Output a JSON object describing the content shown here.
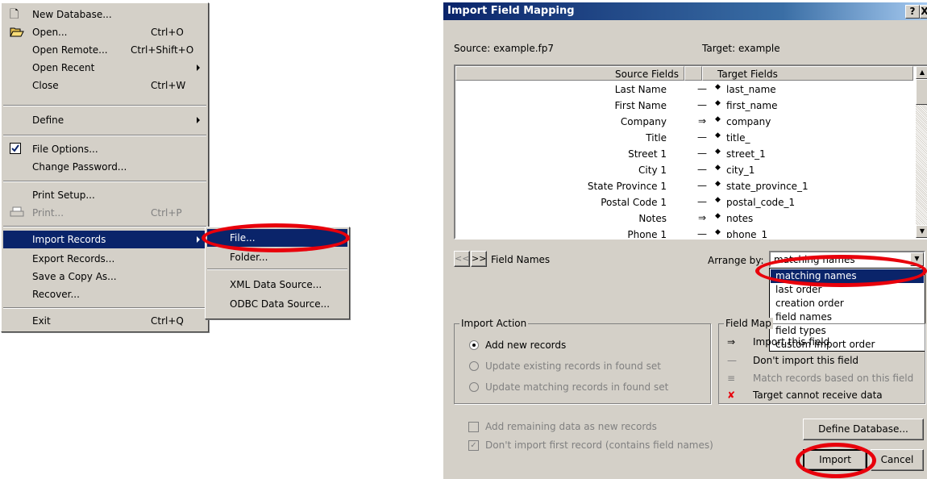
{
  "file_menu": {
    "items": [
      {
        "icon": "new-document-icon",
        "label": "New Database...",
        "shortcut": ""
      },
      {
        "icon": "open-folder-icon",
        "label": "Open...",
        "shortcut": "Ctrl+O"
      },
      {
        "label": "Open Remote...",
        "shortcut": "Ctrl+Shift+O"
      },
      {
        "label": "Open Recent",
        "shortcut": ""
      },
      {
        "label": "Close",
        "shortcut": "Ctrl+W"
      },
      {
        "label": "Define",
        "shortcut": ""
      },
      {
        "icon": "check-icon",
        "label": "File Options...",
        "shortcut": ""
      },
      {
        "label": "Change Password...",
        "shortcut": ""
      },
      {
        "label": "Print Setup...",
        "shortcut": ""
      },
      {
        "icon": "print-icon",
        "label": "Print...",
        "shortcut": "Ctrl+P"
      },
      {
        "label": "Import Records",
        "shortcut": ""
      },
      {
        "label": "Export Records...",
        "shortcut": ""
      },
      {
        "label": "Save a Copy As...",
        "shortcut": ""
      },
      {
        "label": "Recover...",
        "shortcut": ""
      },
      {
        "label": "Exit",
        "shortcut": "Ctrl+Q"
      }
    ]
  },
  "import_submenu": {
    "items": [
      {
        "label": "File..."
      },
      {
        "label": "Folder..."
      },
      {
        "label": "XML Data Source..."
      },
      {
        "label": "ODBC Data Source..."
      }
    ]
  },
  "dialog": {
    "title": "Import Field Mapping",
    "help_btn": "?",
    "close_btn": "X",
    "source_label": "Source: example.fp7",
    "target_label": "Target: example",
    "col_source": "Source Fields",
    "col_target": "Target Fields",
    "rows": [
      {
        "source": "Last Name",
        "arrow": "—",
        "target": "last_name"
      },
      {
        "source": "First Name",
        "arrow": "—",
        "target": "first_name"
      },
      {
        "source": "Company",
        "arrow": "⇒",
        "target": "company"
      },
      {
        "source": "Title",
        "arrow": "—",
        "target": "title_"
      },
      {
        "source": "Street 1",
        "arrow": "—",
        "target": "street_1"
      },
      {
        "source": "City 1",
        "arrow": "—",
        "target": "city_1"
      },
      {
        "source": "State Province 1",
        "arrow": "—",
        "target": "state_province_1"
      },
      {
        "source": "Postal Code 1",
        "arrow": "—",
        "target": "postal_code_1"
      },
      {
        "source": "Notes",
        "arrow": "⇒",
        "target": "notes"
      },
      {
        "source": "Phone 1",
        "arrow": "—",
        "target": "phone_1"
      }
    ],
    "prev_btn": "<<",
    "next_btn": ">>",
    "field_names_label": "Field Names",
    "arrange_by_label": "Arrange by:",
    "arrange_by_value": "matching names",
    "arrange_options": [
      "matching names",
      "last order",
      "creation order",
      "field names",
      "field types",
      "custom import order"
    ],
    "import_action_title": "Import Action",
    "import_actions": [
      "Add new records",
      "Update existing records in found set",
      "Update matching records in found set"
    ],
    "field_mapping_title": "Field Map",
    "mapping_legend": [
      {
        "symbol": "⇒",
        "label": "Import this field"
      },
      {
        "symbol": "—",
        "label": "Don't import this field"
      },
      {
        "symbol": "≡",
        "label": "Match records based on this field"
      },
      {
        "symbol": "✘",
        "label": "Target cannot receive data"
      }
    ],
    "add_remaining_label": "Add remaining data as new records",
    "dont_import_first_label": "Don't import first record (contains field names)",
    "define_db_btn": "Define Database...",
    "import_btn": "Import",
    "cancel_btn": "Cancel"
  }
}
